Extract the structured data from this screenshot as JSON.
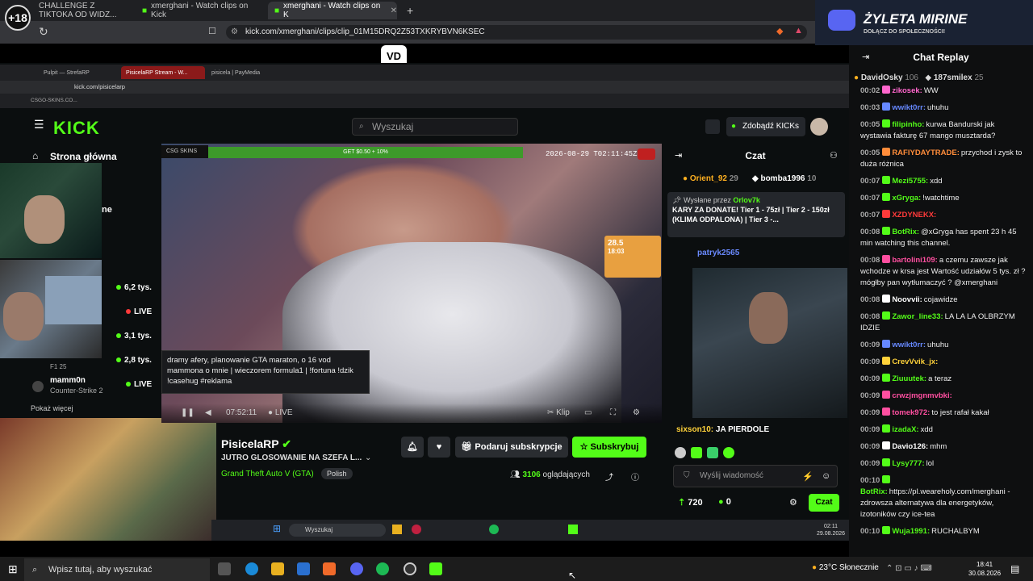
{
  "outer_browser": {
    "tabs": [
      "CHALLENGE Z TIKTOKA OD WIDZ...",
      "xmerghani - Watch clips on Kick",
      "xmerghani - Watch clips on K"
    ],
    "url": "kick.com/xmerghani/clips/clip_01M15DRQ2Z53TXKRYBVN6KSEC"
  },
  "age_badge": "+18",
  "record_badge": "VD",
  "discord": {
    "title": "ŻYLETA MIRINE",
    "subtitle": "DOŁĄCZ DO SPOŁECZNOŚCI!"
  },
  "inner_browser": {
    "tabs": [
      "Pulpit — StrefaRP",
      "PisicelaRP Stream - W...",
      "pisicela | PayMedia"
    ],
    "url": "kick.com/pisicelarp",
    "bookmark": "CSGO-SKINS.CO..."
  },
  "kick": {
    "logo": "KICK",
    "search_placeholder": "Wyszukaj",
    "get_kicks": "Zdobądź KICKs"
  },
  "sidebar": {
    "home": "Strona główna",
    "partial": "ne",
    "viewers": [
      "6,2 tys.",
      "LIVE",
      "3,1 tys.",
      "2,8 tys."
    ],
    "tag_f1": "F1 25",
    "user_mamm0n": "mamm0n",
    "user_game": "Counter-Strike 2",
    "live": "LIVE",
    "show_more": "Pokaż więcej"
  },
  "video": {
    "timestamp": "2026-08-29 T02:11:45Z",
    "banner_get": "GET $0.50 + 10%",
    "weather_temp": "28.5",
    "weather_time": "18:03",
    "tooltip": "dramy afery, planowanie GTA maraton, o 16 vod mammona o mnie | wieczorem formula1 | !fortuna !dzik !casehug #reklama",
    "elapsed": "07:52:11",
    "live": "LIVE",
    "clip": "Klip"
  },
  "stream_info": {
    "channel": "PisicelaRP",
    "title": "JUTRO GLOSOWANIE NA SZEFA L...",
    "game": "Grand Theft Auto V (GTA)",
    "language": "Polish",
    "gift_sub": "Podaruj subskrypcje",
    "subscribe": "Subskrybuj",
    "viewer_count": "3106",
    "viewer_label": "oglądających"
  },
  "inner_chat": {
    "header": "Czat",
    "leader1": "Orient_92",
    "leader1_n": "29",
    "leader2": "bomba1996",
    "leader2_n": "10",
    "pinned_by": "Wysłane przez",
    "pinned_user": "Orlov7k",
    "pinned_text": "KARY ZA DONATE! Tier 1 - 75zł | Tier 2 - 150zł (KLIMA ODPALONA) | Tier 3 -...",
    "msg_user": "patryk2565",
    "last_user": "sixson10:",
    "last_text": "JA PIERDOLE",
    "input_placeholder": "Wyślij wiadomość",
    "points": "720",
    "zero": "0",
    "send": "Czat"
  },
  "inner_taskbar": {
    "search": "Wyszukaj",
    "time": "02:11",
    "date": "29.08.2026"
  },
  "replay": {
    "header": "Chat Replay",
    "leader1": "DavidOsky",
    "leader1_n": "106",
    "leader2": "187smilex",
    "leader2_n": "25",
    "messages": [
      {
        "t": "00:02",
        "u": "zikosek:",
        "c": "#ff66cc",
        "m": "WW"
      },
      {
        "t": "00:03",
        "u": "wwikt0rr:",
        "c": "#6688ff",
        "m": "uhuhu"
      },
      {
        "t": "00:05",
        "u": "filipinho:",
        "c": "#53fc18",
        "m": "kurwa Bandurski jak wystawia fakturę 67 mango musztarda?"
      },
      {
        "t": "00:05",
        "u": "RAFIYDAYTRADE:",
        "c": "#ff8c3a",
        "m": "przychod i zysk to duża różnica"
      },
      {
        "t": "00:07",
        "u": "Mezi5755:",
        "c": "#53fc18",
        "m": "xdd"
      },
      {
        "t": "00:07",
        "u": "xGryga:",
        "c": "#53fc18",
        "m": "!watchtime"
      },
      {
        "t": "00:07",
        "u": "XZDYNEKX:",
        "c": "#ff3a3a",
        "m": ""
      },
      {
        "t": "00:08",
        "u": "BotRix:",
        "c": "#53fc18",
        "m": "@xGryga has spent 23 h 45 min watching this channel."
      },
      {
        "t": "00:08",
        "u": "bartolini109:",
        "c": "#ff4fa0",
        "m": "a czemu zawsze jak wchodze w krsa jest Wartość udziałów 5 tys. zł ? mógłby pan wytłumaczyć ? @xmerghani"
      },
      {
        "t": "00:08",
        "u": "Noovvii:",
        "c": "#ffffff",
        "m": "cojawidze"
      },
      {
        "t": "00:08",
        "u": "Zawor_line33:",
        "c": "#53fc18",
        "m": "LA LA LA OLBRZYM IDZIE"
      },
      {
        "t": "00:09",
        "u": "wwikt0rr:",
        "c": "#6688ff",
        "m": "uhuhu"
      },
      {
        "t": "00:09",
        "u": "CrevVvik_jx:",
        "c": "#ffd23a",
        "m": ""
      },
      {
        "t": "00:09",
        "u": "Ziuuutek:",
        "c": "#53fc18",
        "m": "a teraz"
      },
      {
        "t": "00:09",
        "u": "crwzjmgnmvbki:",
        "c": "#ff4fa0",
        "m": ""
      },
      {
        "t": "00:09",
        "u": "tomek972:",
        "c": "#ff4fa0",
        "m": "to jest rafał kakał"
      },
      {
        "t": "00:09",
        "u": "izadaX:",
        "c": "#53fc18",
        "m": "xdd"
      },
      {
        "t": "00:09",
        "u": "Davio126:",
        "c": "#ffffff",
        "m": "mhm"
      },
      {
        "t": "00:09",
        "u": "Lysy777:",
        "c": "#53fc18",
        "m": "lol"
      },
      {
        "t": "00:10",
        "u": "BotRix:",
        "c": "#53fc18",
        "m": "https://pl.weareholy.com/merghani - zdrowsza alternatywa dla energetyków, izotoników czy ice-tea"
      },
      {
        "t": "00:10",
        "u": "Wuja1991:",
        "c": "#53fc18",
        "m": "RUCHALBYM"
      }
    ]
  },
  "taskbar": {
    "search": "Wpisz tutaj, aby wyszukać",
    "weather": "23°C Słonecznie",
    "time": "18:41",
    "date": "30.08.2026"
  }
}
